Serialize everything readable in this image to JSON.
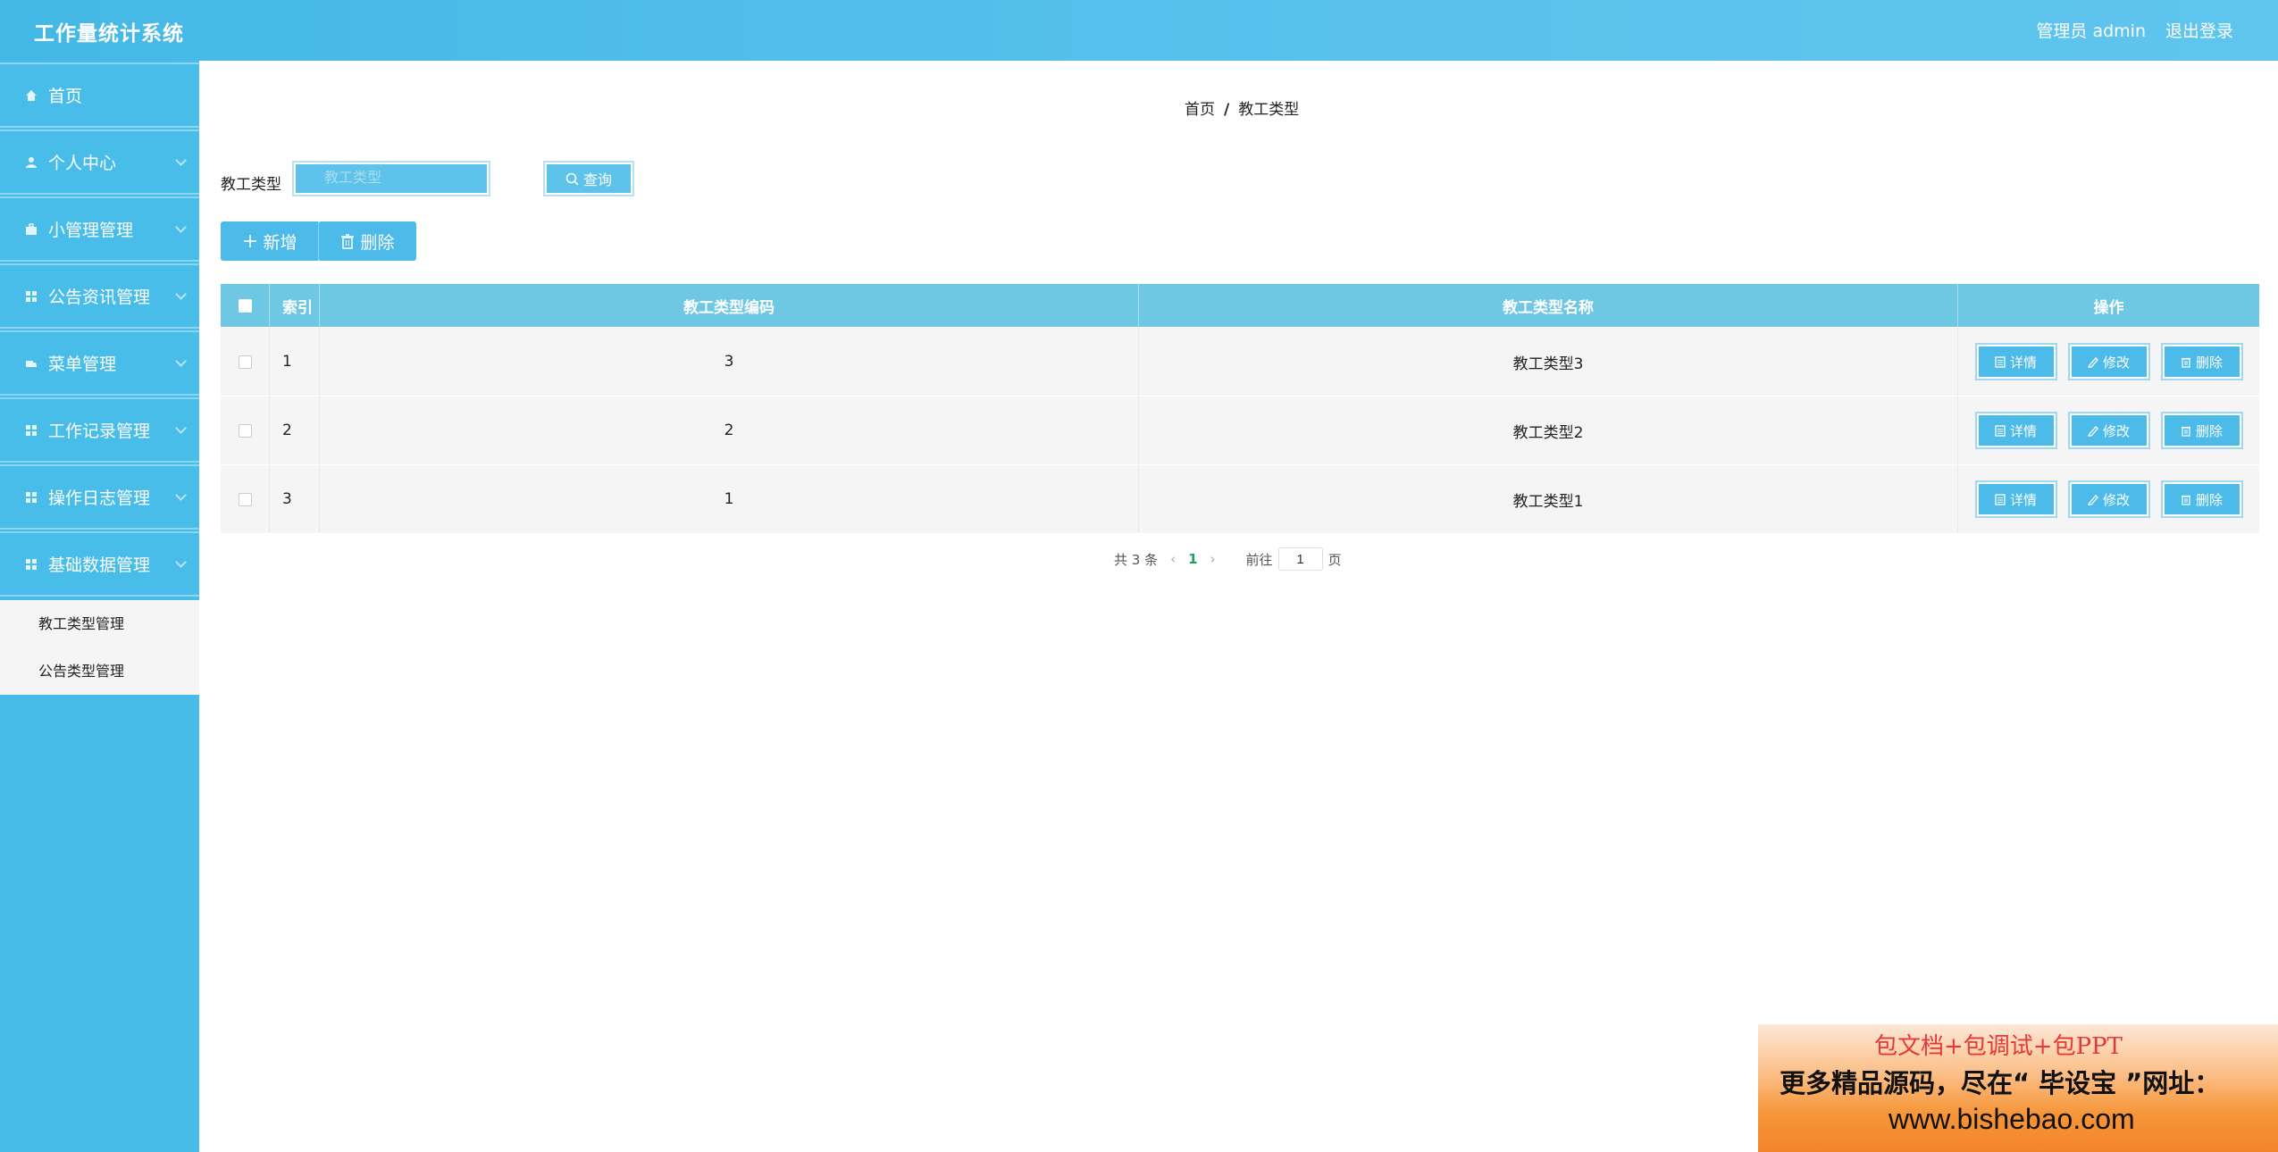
{
  "header": {
    "app_title": "工作量统计系统",
    "user_info": "管理员 admin",
    "logout": "退出登录"
  },
  "sidebar": {
    "items": [
      {
        "label": "首页",
        "icon": "home-icon"
      },
      {
        "label": "个人中心",
        "icon": "user-icon"
      },
      {
        "label": "小管理管理",
        "icon": "briefcase-icon"
      },
      {
        "label": "公告资讯管理",
        "icon": "grid-icon"
      },
      {
        "label": "菜单管理",
        "icon": "truck-icon"
      },
      {
        "label": "工作记录管理",
        "icon": "grid-icon"
      },
      {
        "label": "操作日志管理",
        "icon": "grid-icon"
      },
      {
        "label": "基础数据管理",
        "icon": "grid-icon"
      }
    ],
    "submenu": [
      "教工类型管理",
      "公告类型管理"
    ]
  },
  "breadcrumb": {
    "home": "首页",
    "sep": "/",
    "current": "教工类型"
  },
  "search": {
    "label": "教工类型",
    "placeholder": "教工类型",
    "button": "查询"
  },
  "actions": {
    "add": "新增",
    "delete": "删除"
  },
  "table": {
    "columns": {
      "index": "索引",
      "code": "教工类型编码",
      "name": "教工类型名称",
      "ops": "操作"
    },
    "rows": [
      {
        "index": "1",
        "code": "3",
        "name": "教工类型3"
      },
      {
        "index": "2",
        "code": "2",
        "name": "教工类型2"
      },
      {
        "index": "3",
        "code": "1",
        "name": "教工类型1"
      }
    ],
    "op_labels": {
      "detail": "详情",
      "edit": "修改",
      "delete": "删除"
    }
  },
  "pager": {
    "total": "共 3 条",
    "current_page": "1",
    "goto_label": "前往",
    "goto_value": "1",
    "page_unit": "页"
  },
  "ad": {
    "line1": "包文档+包调试+包PPT",
    "line2": "更多精品源码，尽在“ 毕设宝 ”网址：",
    "line3": "www.bishebao.com"
  }
}
